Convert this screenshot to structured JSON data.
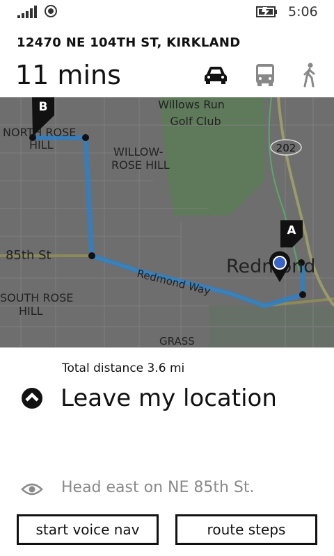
{
  "status_bar": {
    "time": "5:06"
  },
  "route": {
    "address": "12470 NE 104TH ST, KIRKLAND",
    "duration": "11 mins"
  },
  "modes": [
    {
      "name": "drive",
      "icon": "car-icon",
      "selected": true
    },
    {
      "name": "transit",
      "icon": "bus-icon",
      "selected": false
    },
    {
      "name": "walk",
      "icon": "walk-icon",
      "selected": false
    }
  ],
  "map": {
    "labels": {
      "golf_1": "Willows Run",
      "golf_2": "Golf Club",
      "north_rose_hill_1": "NORTH ROSE",
      "north_rose_hill_2": "HILL",
      "willow_rose_1": "WILLOW-",
      "willow_rose_2": "ROSE HILL",
      "street_85th": "85th St",
      "south_rose_1": "SOUTH ROSE",
      "south_rose_2": "HILL",
      "redmond": "Redmond",
      "redmond_way": "Redmond Way",
      "grass": "GRASS",
      "highway": "202"
    },
    "markers": {
      "start": "A",
      "end": "B"
    },
    "colors": {
      "route": "#2f7fc6",
      "map_bg": "#6e6e6e",
      "park": "#5f7a5a"
    }
  },
  "summary": {
    "total_distance": "Total distance 3.6 mi",
    "current_step": "Leave my location",
    "next_hint": "Head east on NE 85th St."
  },
  "actions": {
    "voice_nav": "start voice nav",
    "route_steps": "route steps"
  }
}
